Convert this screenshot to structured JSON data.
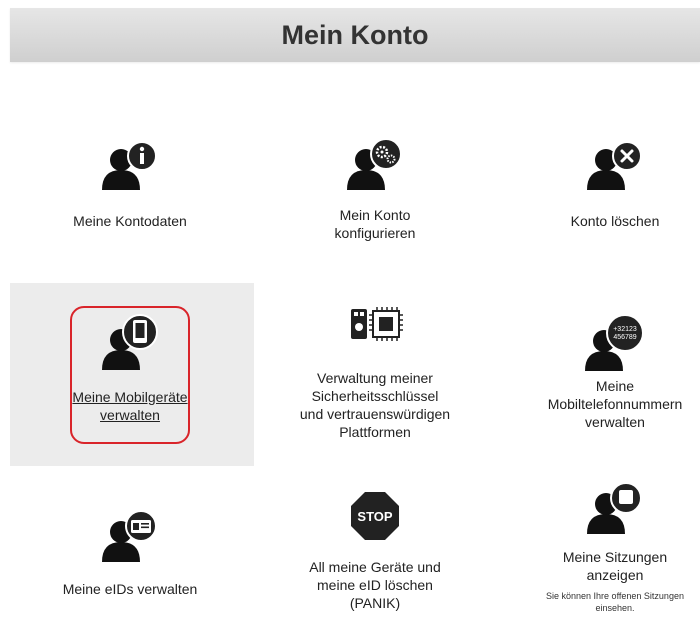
{
  "header": {
    "title": "Mein Konto"
  },
  "tiles": [
    {
      "label_lines": [
        "Meine Kontodaten"
      ]
    },
    {
      "label_lines": [
        "Mein Konto",
        "konfigurieren"
      ]
    },
    {
      "label_lines": [
        "Konto löschen"
      ]
    },
    {
      "label_lines": [
        "Meine Mobilgeräte",
        "verwalten"
      ]
    },
    {
      "label_lines": [
        "Verwaltung meiner",
        "Sicherheitsschlüssel",
        "und vertrauenswürdigen",
        "Plattformen"
      ]
    },
    {
      "label_lines": [
        "Meine",
        "Mobiltelefonnummern",
        "verwalten"
      ],
      "icon_text": [
        "+32123",
        "456789"
      ]
    },
    {
      "label_lines": [
        "Meine eIDs verwalten"
      ]
    },
    {
      "label_lines": [
        "All meine Geräte und",
        "meine eID löschen",
        "(PANIK)"
      ],
      "icon_text": "STOP"
    },
    {
      "label_lines": [
        "Meine Sitzungen",
        "anzeigen"
      ],
      "description_lines": [
        "Sie können Ihre offenen Sitzungen",
        "einsehen."
      ]
    }
  ]
}
